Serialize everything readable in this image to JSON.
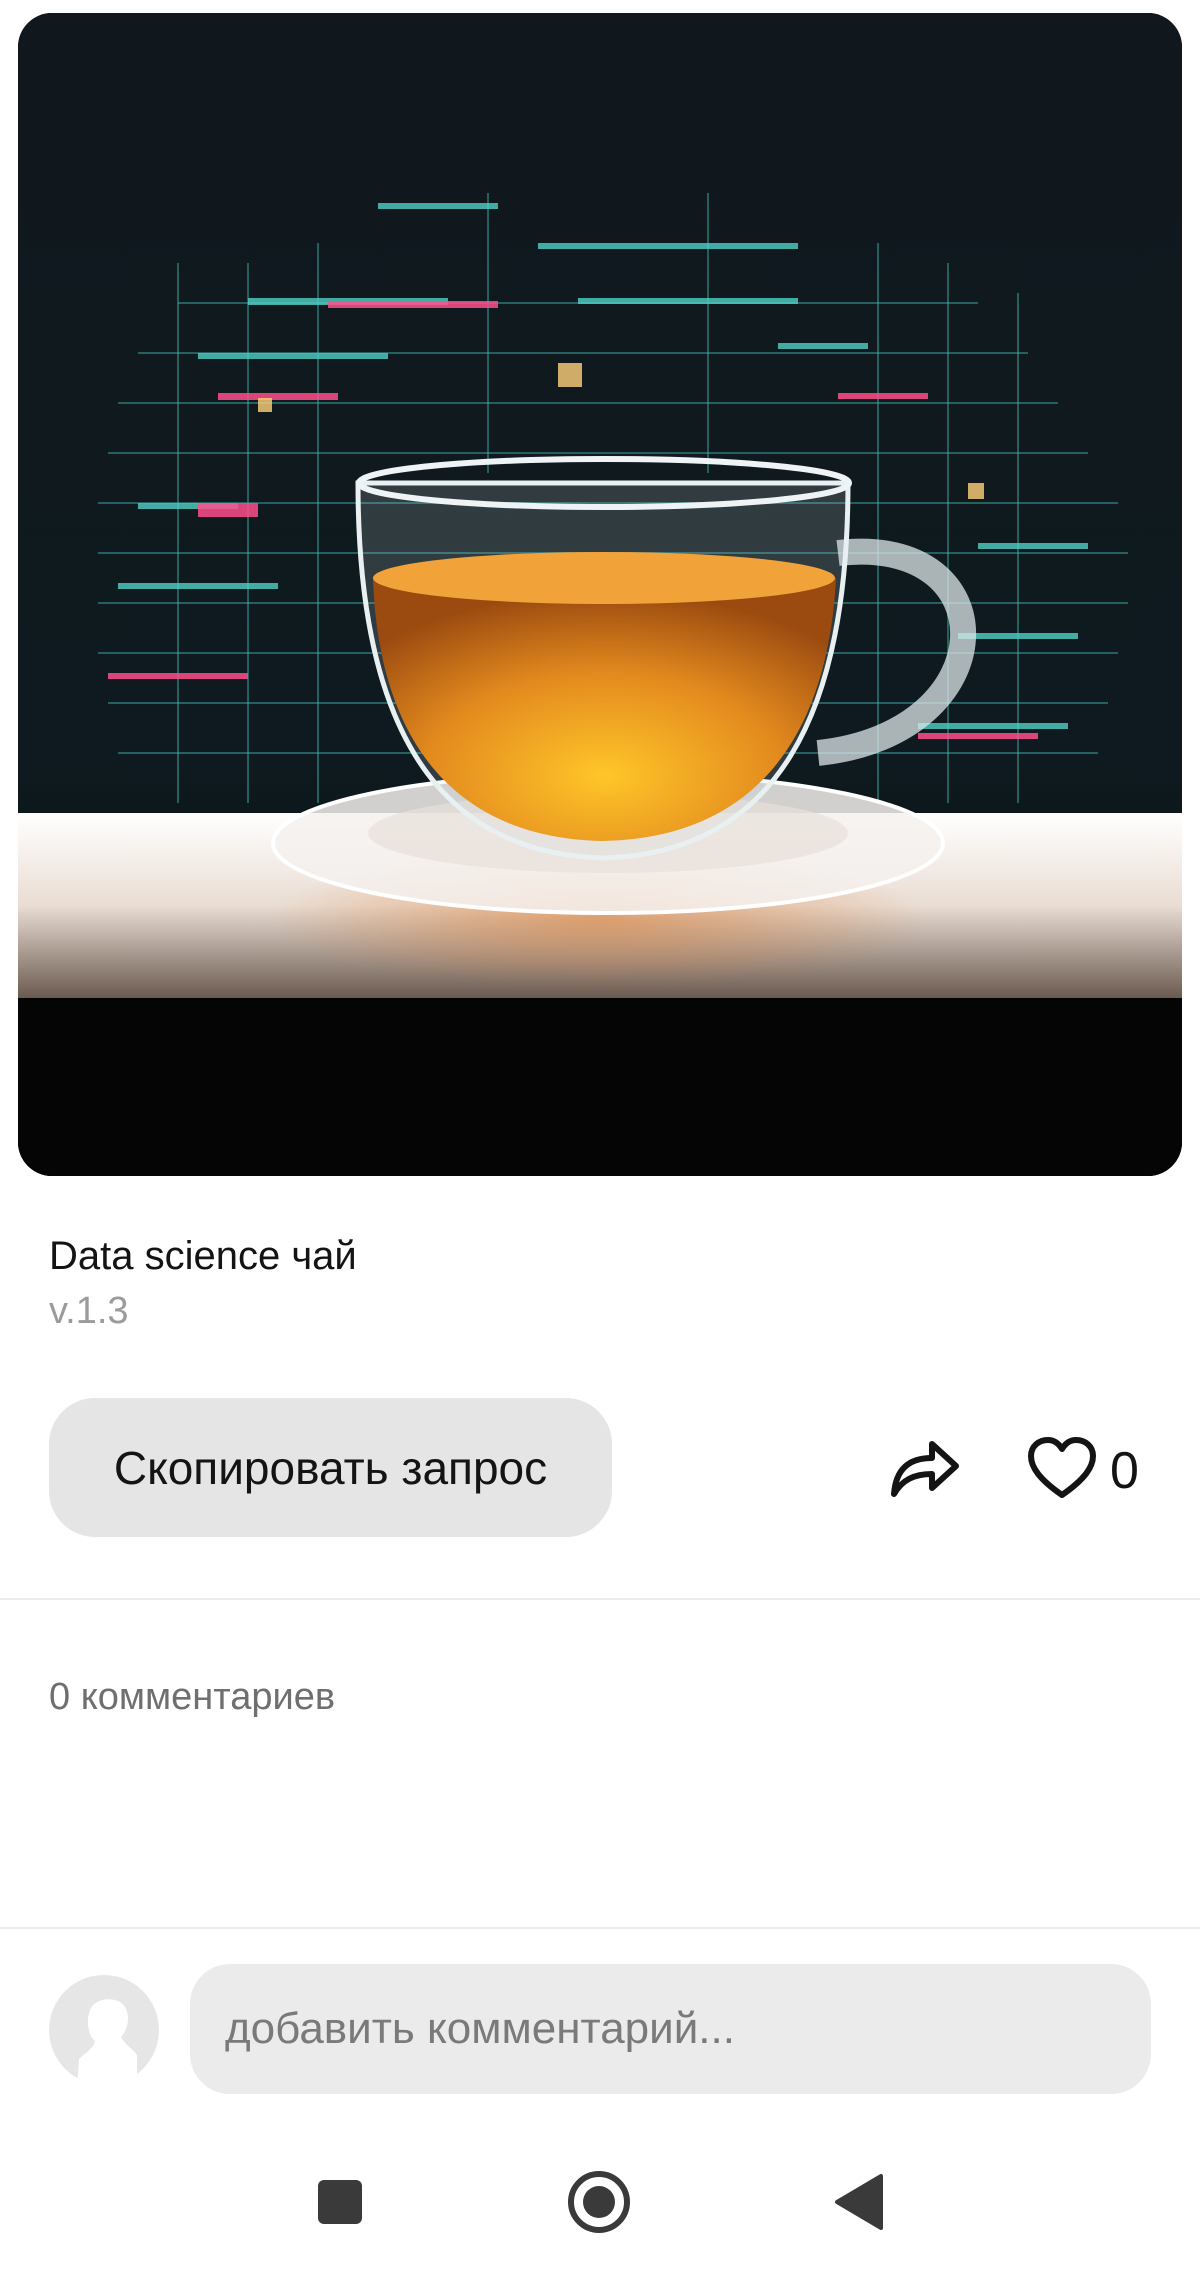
{
  "post": {
    "title": "Data science чай",
    "version": "v.1.3"
  },
  "actions": {
    "copy_label": "Скопировать запрос",
    "share_icon": "share-arrow-icon",
    "like_icon": "heart-outline-icon",
    "like_count": "0"
  },
  "comments": {
    "count_label": "0 комментариев",
    "input_placeholder": "добавить комментарий..."
  },
  "system_nav": {
    "recents_icon": "square-icon",
    "home_icon": "circle-icon",
    "back_icon": "triangle-back-icon"
  },
  "colors": {
    "button_bg": "#e5e5e5",
    "input_bg": "#ebebeb",
    "tea": "#e38a1e",
    "data_cyan": "#4fd1c5",
    "data_pink": "#ff4f8b"
  }
}
